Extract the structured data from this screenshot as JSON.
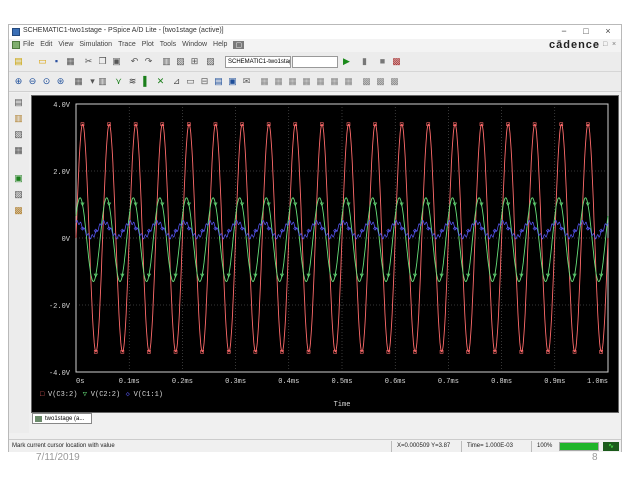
{
  "window": {
    "title": "SCHEMATIC1-two1stage - PSpice A/D Lite - [two1stage (active)]",
    "min_glyph": "−",
    "max_glyph": "□",
    "close_glyph": "×"
  },
  "menu": {
    "items": [
      "File",
      "Edit",
      "View",
      "Simulation",
      "Trace",
      "Plot",
      "Tools",
      "Window",
      "Help"
    ],
    "active_item_glyph": "▢",
    "brand": "cādence",
    "mdi_min": "−",
    "mdi_max": "□",
    "mdi_close": "×"
  },
  "toolbar": {
    "profile_value": "SCHEMATIC1-two1stage",
    "search_value": ""
  },
  "chart_data": {
    "type": "line",
    "title": "",
    "xlabel": "Time",
    "ylabel": "",
    "xlim": [
      0,
      1.0
    ],
    "ylim": [
      -4.0,
      4.0
    ],
    "x_unit": "ms",
    "x_ticks": [
      "0s",
      "0.1ms",
      "0.2ms",
      "0.3ms",
      "0.4ms",
      "0.5ms",
      "0.6ms",
      "0.7ms",
      "0.8ms",
      "0.9ms",
      "1.0ms"
    ],
    "y_ticks": [
      "4.0V",
      "2.0V",
      "0V",
      "-2.0V",
      "-4.0V"
    ],
    "y_tick_values": [
      4.0,
      2.0,
      0.0,
      -2.0,
      -4.0
    ],
    "grid": true,
    "legend_placement": "bottom-left",
    "series": [
      {
        "name": "V(C3:2)",
        "color": "#ff6b6b",
        "marker": "□",
        "amplitude_v": 3.4,
        "offset_v": 0.0,
        "frequency_khz": 20,
        "cycles_visible": 20
      },
      {
        "name": "V(C2:2)",
        "color": "#66e07a",
        "marker": "▽",
        "amplitude_v": 1.25,
        "offset_v": -0.05,
        "frequency_khz": 20,
        "cycles_visible": 20
      },
      {
        "name": "V(C1:1)",
        "color": "#5b5bff",
        "marker": "◇",
        "amplitude_v": 0.22,
        "offset_v": 0.25,
        "frequency_khz": 20,
        "cycles_visible": 20
      }
    ]
  },
  "tab": {
    "label": "two1stage (a..."
  },
  "status": {
    "message": "Mark current cursor location with value",
    "cursor_readout": "X=0.000509  Y=3.87",
    "time_readout": "Time= 1.000E-03",
    "progress_label": "100%",
    "progress_fraction": 1.0
  },
  "slide_footer": {
    "date": "7/11/2019",
    "page": "8"
  },
  "icons": {
    "toolbar": [
      "new-file-icon",
      "open-folder-icon",
      "save-icon",
      "print-icon",
      "cut-icon",
      "copy-icon",
      "paste-icon",
      "undo-icon",
      "redo-icon",
      "zoom-in-icon",
      "zoom-out-icon",
      "zoom-area-icon",
      "zoom-fit-icon"
    ],
    "colors": {
      "plot_bg": "#000000",
      "grid": "#6e6e6e",
      "axis_text": "#d8d8d8"
    }
  }
}
